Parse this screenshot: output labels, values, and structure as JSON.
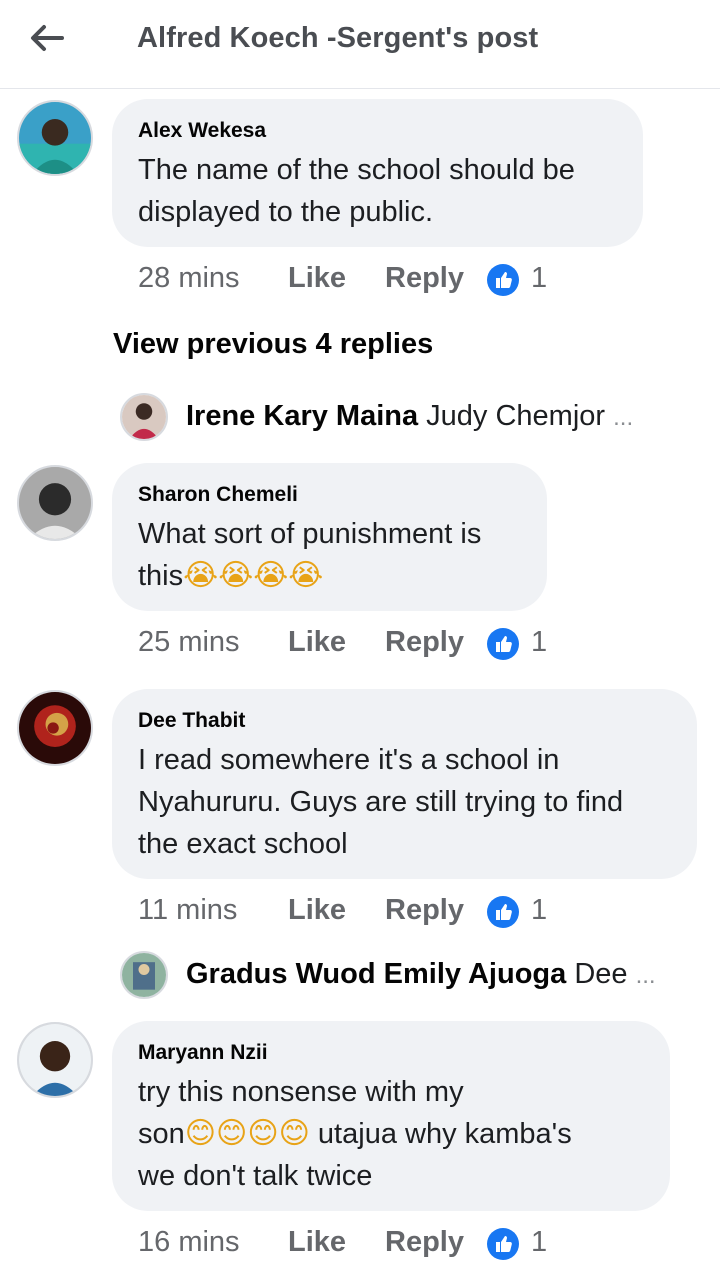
{
  "header": {
    "title": "Alfred Koech -Sergent's post"
  },
  "view_previous_label": "View previous 4 replies",
  "comments": [
    {
      "author": "Alex Wekesa",
      "lines": [
        "The name of the school should be",
        "displayed to the public."
      ],
      "time": "28 mins",
      "like_label": "Like",
      "reply_label": "Reply",
      "reaction_count": "1"
    },
    {
      "author": "Sharon Chemeli",
      "lines": [
        "What sort of punishment is",
        "this"
      ],
      "emoji_line2": "😭😭😭😭",
      "time": "25 mins",
      "like_label": "Like",
      "reply_label": "Reply",
      "reaction_count": "1"
    },
    {
      "author": "Dee Thabit",
      "lines": [
        "I read somewhere it's a school in",
        "Nyahururu. Guys are still trying to find",
        "the exact school"
      ],
      "time": "11 mins",
      "like_label": "Like",
      "reply_label": "Reply",
      "reaction_count": "1"
    },
    {
      "author": "Maryann Nzii",
      "lines": [
        " try this nonsense with my",
        "son",
        " utajua why kamba's",
        "we don't talk twice"
      ],
      "emoji_line2": "😊😊😊😊",
      "time": "16 mins",
      "like_label": "Like",
      "reply_label": "Reply",
      "reaction_count": "1"
    }
  ],
  "reply_previews": [
    {
      "name": "Irene Kary Maina",
      "text": "Judy Chemjor",
      "ellipsis": "..."
    },
    {
      "name": "Gradus Wuod Emily Ajuoga",
      "text": "Dee",
      "ellipsis": "..."
    }
  ],
  "icons": {
    "back": "arrow-left-icon",
    "reaction": "thumbs-up-icon"
  },
  "colors": {
    "accent": "#1877f2",
    "bubble": "#f0f2f5",
    "muted": "#65676b"
  }
}
